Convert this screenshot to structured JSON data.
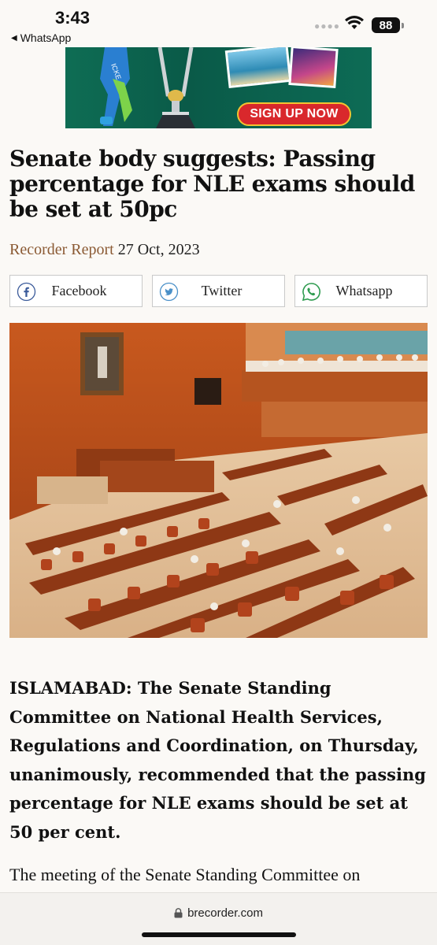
{
  "status_bar": {
    "time": "3:43",
    "back_app": "WhatsApp",
    "battery": "88"
  },
  "ad": {
    "cta": "SIGN UP NOW"
  },
  "article": {
    "title": "Senate body suggests: Passing percentage for NLE exams should be set at 50pc",
    "author": "Recorder Report",
    "date": "27 Oct, 2023",
    "lead": "ISLAMABAD: The Senate Standing Committee on National Health Services, Regulations and Coordination, on Thursday, unanimously, recommended that the passing percentage for NLE exams should be set at 50 per cent.",
    "paragraph_2": "The meeting of the Senate Standing Committee on"
  },
  "share": [
    {
      "label": "Facebook",
      "icon": "facebook-icon"
    },
    {
      "label": "Twitter",
      "icon": "twitter-icon"
    },
    {
      "label": "Whatsapp",
      "icon": "whatsapp-icon"
    }
  ],
  "browser": {
    "url": "brecorder.com"
  },
  "colors": {
    "author": "#8b5a34",
    "ad_green": "#0e6d54",
    "cta_red": "#d9282c"
  }
}
